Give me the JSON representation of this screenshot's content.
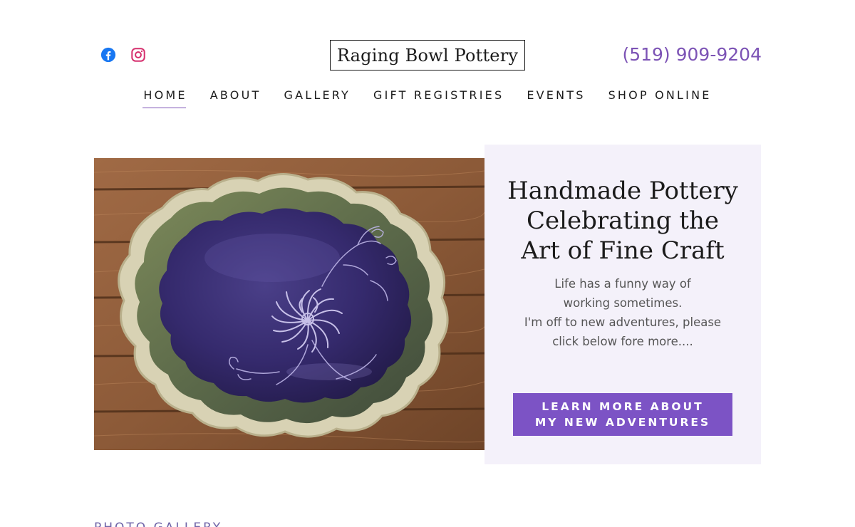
{
  "header": {
    "site_title": "Raging Bowl Pottery",
    "phone": "(519) 909-9204",
    "social": [
      {
        "icon": "facebook-icon",
        "color": "#1877f2"
      },
      {
        "icon": "instagram-icon",
        "color": "#d6306e"
      }
    ]
  },
  "nav": {
    "items": [
      {
        "label": "HOME",
        "active": true
      },
      {
        "label": "ABOUT",
        "active": false
      },
      {
        "label": "GALLERY",
        "active": false
      },
      {
        "label": "GIFT REGISTRIES",
        "active": false
      },
      {
        "label": "EVENTS",
        "active": false
      },
      {
        "label": "SHOP ONLINE",
        "active": false
      }
    ]
  },
  "hero": {
    "title_lines": [
      "Handmade Pottery",
      "Celebrating the",
      "Art of Fine Craft"
    ],
    "body_lines": [
      "Life has a funny way of",
      "working sometimes.",
      "I'm off to new adventures, please",
      "click below fore more...."
    ],
    "cta_lines": [
      "LEARN MORE ABOUT",
      "MY NEW ADVENTURES"
    ],
    "image_subject": "scalloped purple glazed ceramic platter with carved chrysanthemum on wooden table"
  },
  "section": {
    "heading": "PHOTO GALLERY"
  },
  "colors": {
    "accent": "#7c53b5",
    "cta_background": "#7c53c5",
    "hero_panel": "#f4f1fa",
    "text_dark": "#1b1b1b",
    "text_body": "#555555"
  }
}
